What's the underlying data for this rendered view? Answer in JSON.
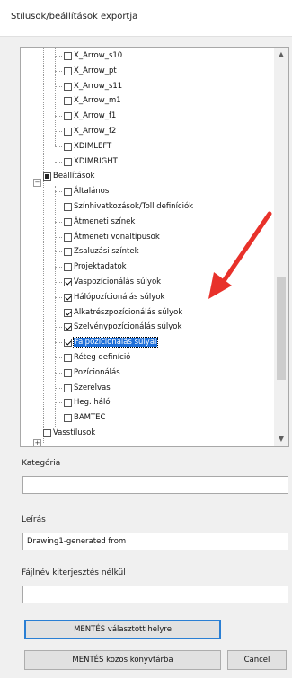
{
  "window": {
    "title": "Stílusok/beállítások exportja"
  },
  "tree": {
    "items": [
      {
        "label": "X_Arrow_s10",
        "checked": false
      },
      {
        "label": "X_Arrow_pt",
        "checked": false
      },
      {
        "label": "X_Arrow_s11",
        "checked": false
      },
      {
        "label": "X_Arrow_m1",
        "checked": false
      },
      {
        "label": "X_Arrow_f1",
        "checked": false
      },
      {
        "label": "X_Arrow_f2",
        "checked": false
      },
      {
        "label": "XDIMLEFT",
        "checked": false
      },
      {
        "label": "XDIMRIGHT",
        "checked": false
      },
      {
        "label": "Beállítások",
        "checked": "partial"
      },
      {
        "label": "Általános",
        "checked": false
      },
      {
        "label": "Színhivatkozások/Toll definíciók",
        "checked": false
      },
      {
        "label": "Átmeneti színek",
        "checked": false
      },
      {
        "label": "Átmeneti vonaltípusok",
        "checked": false
      },
      {
        "label": "Zsaluzási színtek",
        "checked": false
      },
      {
        "label": "Projektadatok",
        "checked": false
      },
      {
        "label": "Vaspozícionálás súlyok",
        "checked": true
      },
      {
        "label": "Hálópozícionálás súlyok",
        "checked": true
      },
      {
        "label": "Alkatrészpozícionálás súlyok",
        "checked": true
      },
      {
        "label": "Szelvénypozícionálás súlyok",
        "checked": true
      },
      {
        "label": "Falpozícionálás súlyai",
        "checked": true
      },
      {
        "label": "Réteg definíció",
        "checked": false
      },
      {
        "label": "Pozícionálás",
        "checked": false
      },
      {
        "label": "Szerelvas",
        "checked": false
      },
      {
        "label": "Heg. háló",
        "checked": false
      },
      {
        "label": "BAMTEC",
        "checked": false
      },
      {
        "label": "Vasstílusok",
        "checked": false
      }
    ]
  },
  "kategoria": {
    "label": "Kategória",
    "value": ""
  },
  "leiras": {
    "label": "Leírás",
    "value": "Drawing1-generated from"
  },
  "fajlnev": {
    "label": "Fájlnév kiterjesztés nélkül",
    "value": ""
  },
  "buttons": {
    "save_selected": "MENTÉS választott helyre",
    "save_common": "MENTÉS közös könyvtárba",
    "cancel": "Cancel"
  },
  "colors": {
    "selection": "#1e6fd9",
    "arrow": "#e8312a"
  }
}
